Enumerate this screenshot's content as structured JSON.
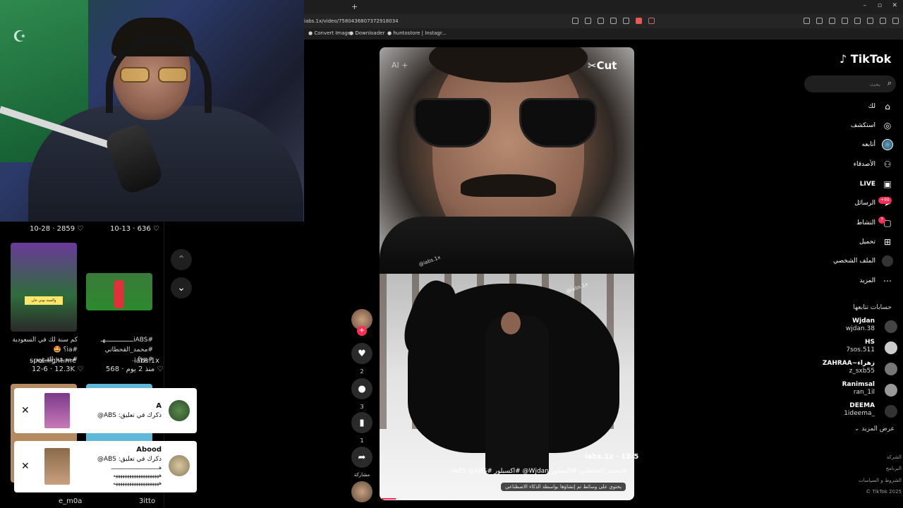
{
  "browser": {
    "new_tab": "+",
    "url": "iabs.1x/video/7580436807372918034",
    "bookmarks": [
      "Convert Image",
      "Downloader",
      "huntostore | Instagr..."
    ],
    "window_controls": [
      "–",
      "▫",
      "✕"
    ]
  },
  "left_grid": {
    "top_stats": [
      {
        "date": "10-28",
        "likes": "2859"
      },
      {
        "date": "10-13",
        "likes": "636"
      }
    ],
    "cards": [
      {
        "caption": "كم سنة لك في السعودية #ia؟ 🤩 #حديقة_السويد...",
        "user": "spot.light.me",
        "date": "12-6",
        "likes": "12.3K",
        "thumb_text": "والسيد يوني خان"
      },
      {
        "caption": "#iABSـــــــــــــــهـ #محمد_القحطاني #fyp...",
        "user": "iabs.1x",
        "date": "منذ 2 يوم",
        "likes": "568"
      }
    ],
    "bottom_users": [
      "e_m0a",
      "3itto"
    ]
  },
  "notifications": [
    {
      "name": "A",
      "body": "ذكرك في تعليق: ABS@"
    },
    {
      "name": "Abood",
      "body": "ذكرك في تعليق: ABS@",
      "body2": "هـــــــــــــــــــــــــــــــــ",
      "body3": "ههههههههههههههههههههه",
      "body4": "ههههههههههههههههههههه"
    }
  ],
  "nav": {
    "up": "⌃",
    "down": "⌄"
  },
  "video": {
    "cut_logo": "✂Cut",
    "watermark_tl": "AI +",
    "watermark1": "@iabs.1x",
    "watermark2": "@iabs.1x",
    "user": "iabs.1x · 12-5",
    "caption": "#محمد_القحطاني #اكسبلور Wjdan@ #اكسبلور #iABS @ABS",
    "ai_label": "يحتوي على وسائط تم إنشاؤها بواسطة الذكاء الاصطناعي"
  },
  "actions": {
    "likes": "2",
    "comments": "3",
    "saves": "1",
    "share_label": "مشاركة"
  },
  "sidebar": {
    "logo": "TikTok",
    "search_placeholder": "بحث",
    "menu": [
      {
        "label": "لك",
        "icon": "home-icon"
      },
      {
        "label": "استكشف",
        "icon": "compass-icon"
      },
      {
        "label": "أتابعه",
        "icon": "following-avatar"
      },
      {
        "label": "الأصدقاء",
        "icon": "friends-icon"
      },
      {
        "label": "LIVE",
        "icon": "live-icon"
      },
      {
        "label": "الرسائل",
        "icon": "messages-icon",
        "badge": "+99"
      },
      {
        "label": "النشاط",
        "icon": "activity-icon",
        "badge": "7"
      },
      {
        "label": "تحميل",
        "icon": "upload-icon"
      },
      {
        "label": "الملف الشخصي",
        "icon": "profile-avatar"
      },
      {
        "label": "المزيد",
        "icon": "more-icon"
      }
    ],
    "following_title": "حسابات تتابعها",
    "accounts": [
      {
        "name": "Wjdan",
        "handle": "wjdan.38"
      },
      {
        "name": "HS",
        "handle": "7sos.511"
      },
      {
        "name": "ZAHRAA~زهراء",
        "handle": "z_sxb55"
      },
      {
        "name": "Ranimsaا",
        "handle": "ran_1il"
      },
      {
        "name": "DEEMA",
        "handle": "1ideema_"
      }
    ],
    "show_more": "عرض المزيد",
    "footer": [
      "الشركة",
      "البرنامج",
      "الشروط و السياسات",
      "TikTok 2025 ©"
    ]
  },
  "colors": {
    "accent": "#fe2c55",
    "bg": "#000000"
  }
}
